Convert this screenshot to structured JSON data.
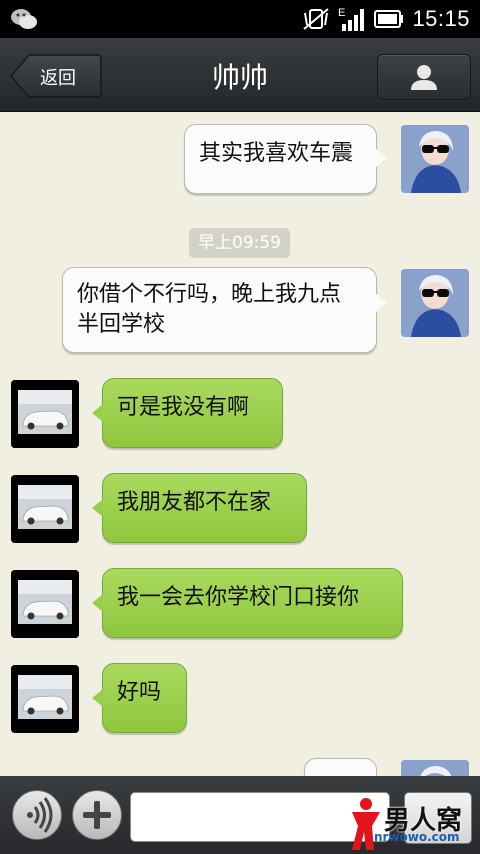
{
  "status_bar": {
    "time": "15:15",
    "network_label": "E",
    "icons": [
      "wechat-icon",
      "mute-vibrate-icon",
      "signal-icon",
      "battery-icon"
    ]
  },
  "header": {
    "back_label": "返回",
    "title": "帅帅",
    "profile_icon": "person-icon"
  },
  "messages": [
    {
      "side": "right",
      "avatar": "girl-sunglasses-avatar",
      "text": "其实我喜欢车震"
    },
    {
      "type": "timestamp",
      "text": "早上09:59"
    },
    {
      "side": "right",
      "avatar": "girl-sunglasses-avatar",
      "text": "你借个不行吗，晚上我九点半回学校"
    },
    {
      "side": "left",
      "avatar": "white-car-avatar",
      "text": "可是我没有啊"
    },
    {
      "side": "left",
      "avatar": "white-car-avatar",
      "text": "我朋友都不在家"
    },
    {
      "side": "left",
      "avatar": "white-car-avatar",
      "text": "我一会去你学校门口接你"
    },
    {
      "side": "left",
      "avatar": "white-car-avatar",
      "text": "好吗"
    }
  ],
  "input_bar": {
    "voice_icon": "voice-icon",
    "plus_icon": "plus-icon",
    "message_value": "",
    "send_label": ""
  },
  "watermark": {
    "name": "男人窝",
    "url": "nrwowo.com"
  },
  "colors": {
    "chat_background": "#f1efe1",
    "incoming_bubble": "#99cf48",
    "outgoing_bubble": "#fbfbfb",
    "bar_background": "#2f3235"
  }
}
